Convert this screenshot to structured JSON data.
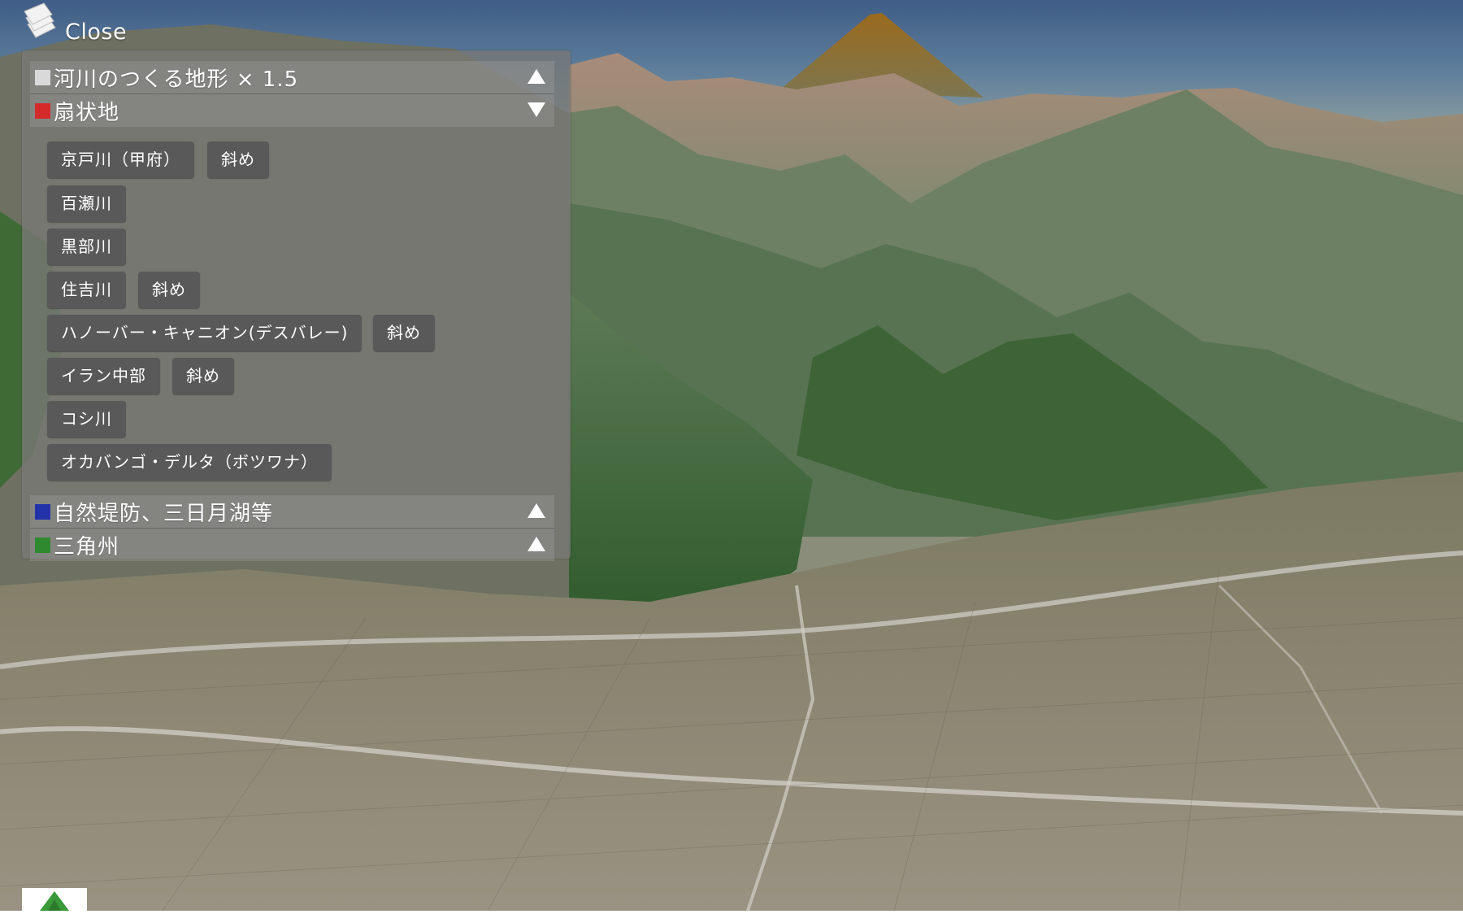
{
  "window": {
    "close_label": "Close"
  },
  "panel": {
    "sections": [
      {
        "label": "河川のつくる地形 × 1.5",
        "swatch_color": "#d9d9d9",
        "state": "collapsed",
        "arrow": "up"
      },
      {
        "label": "扇状地",
        "swatch_color": "#d42a2a",
        "state": "expanded",
        "arrow": "down"
      },
      {
        "label": "自然堤防、三日月湖等",
        "swatch_color": "#2233aa",
        "state": "collapsed",
        "arrow": "up"
      },
      {
        "label": "三角州",
        "swatch_color": "#2f8a2f",
        "state": "collapsed",
        "arrow": "up"
      }
    ],
    "fan_buttons": [
      {
        "label": "京戸川（甲府）"
      },
      {
        "label": "斜め"
      },
      {
        "label": "百瀬川"
      },
      {
        "label": "黒部川"
      },
      {
        "label": "住吉川"
      },
      {
        "label": "斜め"
      },
      {
        "label": "ハノーバー・キャニオン(デスバレー)"
      },
      {
        "label": "斜め"
      },
      {
        "label": "イラン中部"
      },
      {
        "label": "斜め"
      },
      {
        "label": "コシ川"
      },
      {
        "label": "オカバンゴ・デルタ（ボツワナ）"
      }
    ]
  },
  "icons": {
    "close": "layers-stack-icon",
    "collapse_up": "triangle-up-icon",
    "expand_down": "triangle-down-icon",
    "logo": "green-triangle-logo"
  },
  "colors": {
    "panel_bg": "rgba(120,120,118,0.78)",
    "button_bg": "#595959",
    "button_text": "#ffffff"
  }
}
